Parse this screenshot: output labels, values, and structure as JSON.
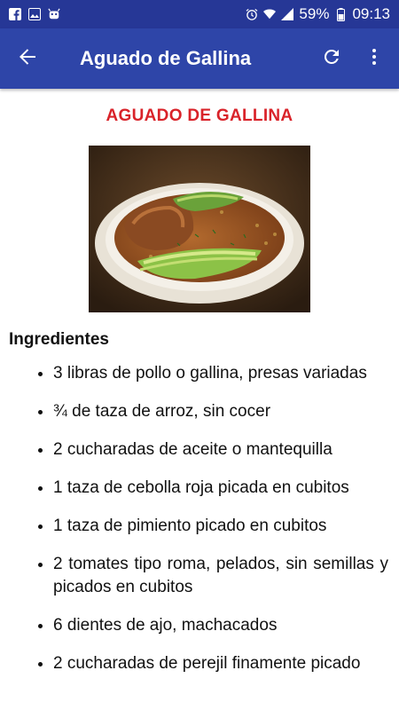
{
  "status": {
    "battery_percent": "59%",
    "time": "09:13",
    "notification_icons": [
      "facebook-icon",
      "image-icon",
      "android-icon"
    ],
    "system_icons": [
      "alarm-icon",
      "wifi-icon",
      "signal-icon",
      "battery-icon"
    ]
  },
  "appbar": {
    "title": "Aguado de Gallina",
    "back_icon": "arrow-left-icon",
    "refresh_icon": "refresh-icon",
    "menu_icon": "more-vert-icon"
  },
  "recipe": {
    "title": "AGUADO DE GALLINA",
    "section_title": "Ingredientes",
    "ingredients": [
      "3 libras de pollo o gallina, presas variadas",
      "¾ de taza de arroz, sin cocer",
      "2 cucharadas de aceite o mantequilla",
      "1 taza de cebolla roja picada en cubitos",
      "1 taza de pimiento picado en cubitos",
      "2 tomates tipo roma, pelados, sin semillas y picados en cubitos",
      "6 dientes de ajo, machacados",
      "2 cucharadas de perejil finamente picado"
    ]
  },
  "colors": {
    "statusbar": "#263796",
    "appbar": "#2e45a8",
    "recipe_title": "#d9232a"
  }
}
